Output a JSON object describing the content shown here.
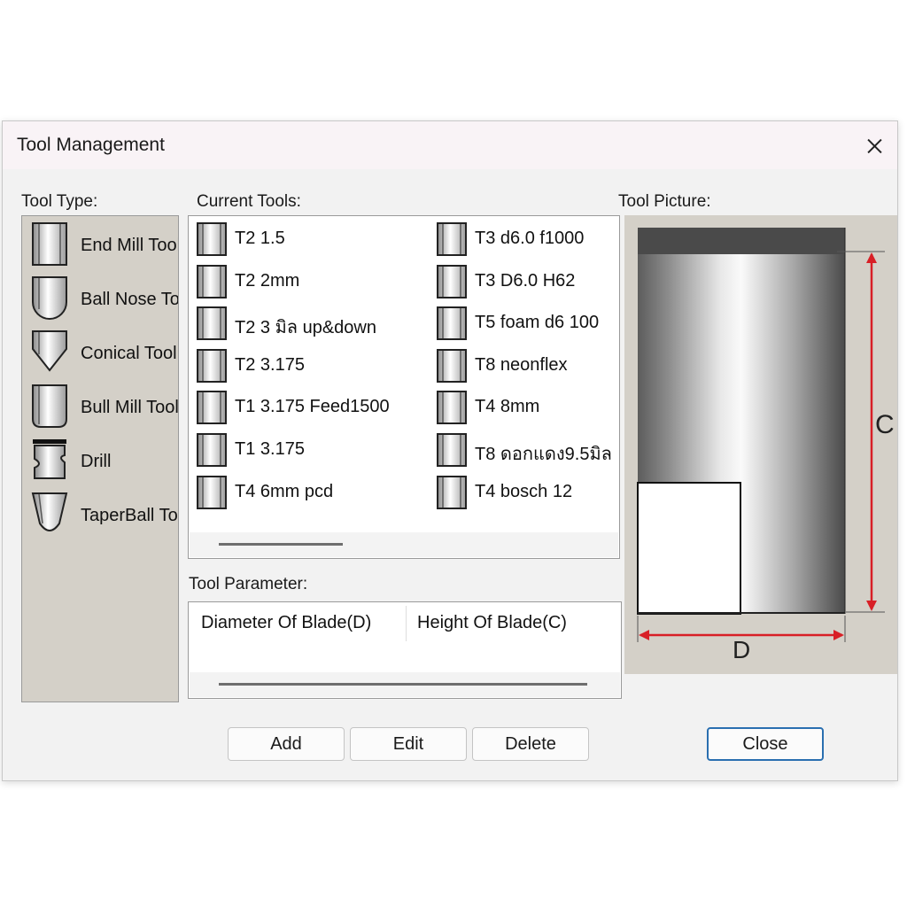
{
  "window": {
    "title": "Tool Management"
  },
  "tool_type": {
    "label": "Tool Type:",
    "items": [
      {
        "label": "End Mill Tool",
        "icon": "end-mill-icon"
      },
      {
        "label": "Ball Nose Tool",
        "icon": "ball-nose-icon"
      },
      {
        "label": "Conical Tool",
        "icon": "conical-icon"
      },
      {
        "label": "Bull Mill Tool",
        "icon": "bull-mill-icon"
      },
      {
        "label": "Drill",
        "icon": "drill-icon"
      },
      {
        "label": "TaperBall Tool",
        "icon": "taper-ball-icon"
      }
    ]
  },
  "current_tools": {
    "label": "Current Tools:",
    "items": [
      "T2 1.5",
      "T2 2mm",
      "T2  3 มิล up&down",
      "T2 3.175",
      "T1 3.175 Feed1500",
      "T1 3.175",
      "T4 6mm pcd",
      "T3 d6.0 f1000",
      "T3 D6.0 H62",
      "T5 foam d6 100",
      "T8 neonflex",
      "T4 8mm",
      "T8 ดอกแดง9.5มิล",
      "T4 bosch 12"
    ]
  },
  "tool_parameter": {
    "label": "Tool Parameter:",
    "columns": [
      "Diameter Of Blade(D)",
      "Height Of Blade(C)"
    ]
  },
  "tool_picture": {
    "label": "Tool Picture:",
    "height_marker": "C",
    "diameter_marker": "D",
    "dimension_color": "#d81f26"
  },
  "buttons": {
    "add": "Add",
    "edit": "Edit",
    "delete": "Delete",
    "close": "Close"
  },
  "colors": {
    "accent": "#2a6fb0",
    "panel": "#d4d0c8"
  }
}
